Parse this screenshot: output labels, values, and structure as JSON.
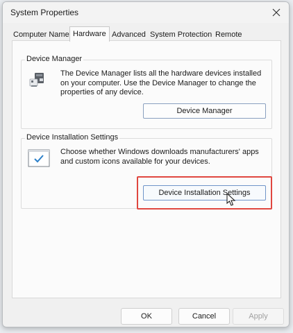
{
  "window": {
    "title": "System Properties"
  },
  "tabs": [
    {
      "label": "Computer Name"
    },
    {
      "label": "Hardware",
      "active": true
    },
    {
      "label": "Advanced"
    },
    {
      "label": "System Protection"
    },
    {
      "label": "Remote"
    }
  ],
  "device_manager": {
    "group_label": "Device Manager",
    "description": "The Device Manager lists all the hardware devices installed on your computer. Use the Device Manager to change the properties of any device.",
    "button_label": "Device Manager",
    "icon": "device-manager-icon"
  },
  "device_installation": {
    "group_label": "Device Installation Settings",
    "description": "Choose whether Windows downloads manufacturers' apps and custom icons available for your devices.",
    "button_label": "Device Installation Settings",
    "icon": "checkbox-window-icon"
  },
  "footer": {
    "ok_label": "OK",
    "cancel_label": "Cancel",
    "apply_label": "Apply"
  },
  "colors": {
    "highlight": "#e0463f",
    "accent": "#2a7fc9"
  }
}
